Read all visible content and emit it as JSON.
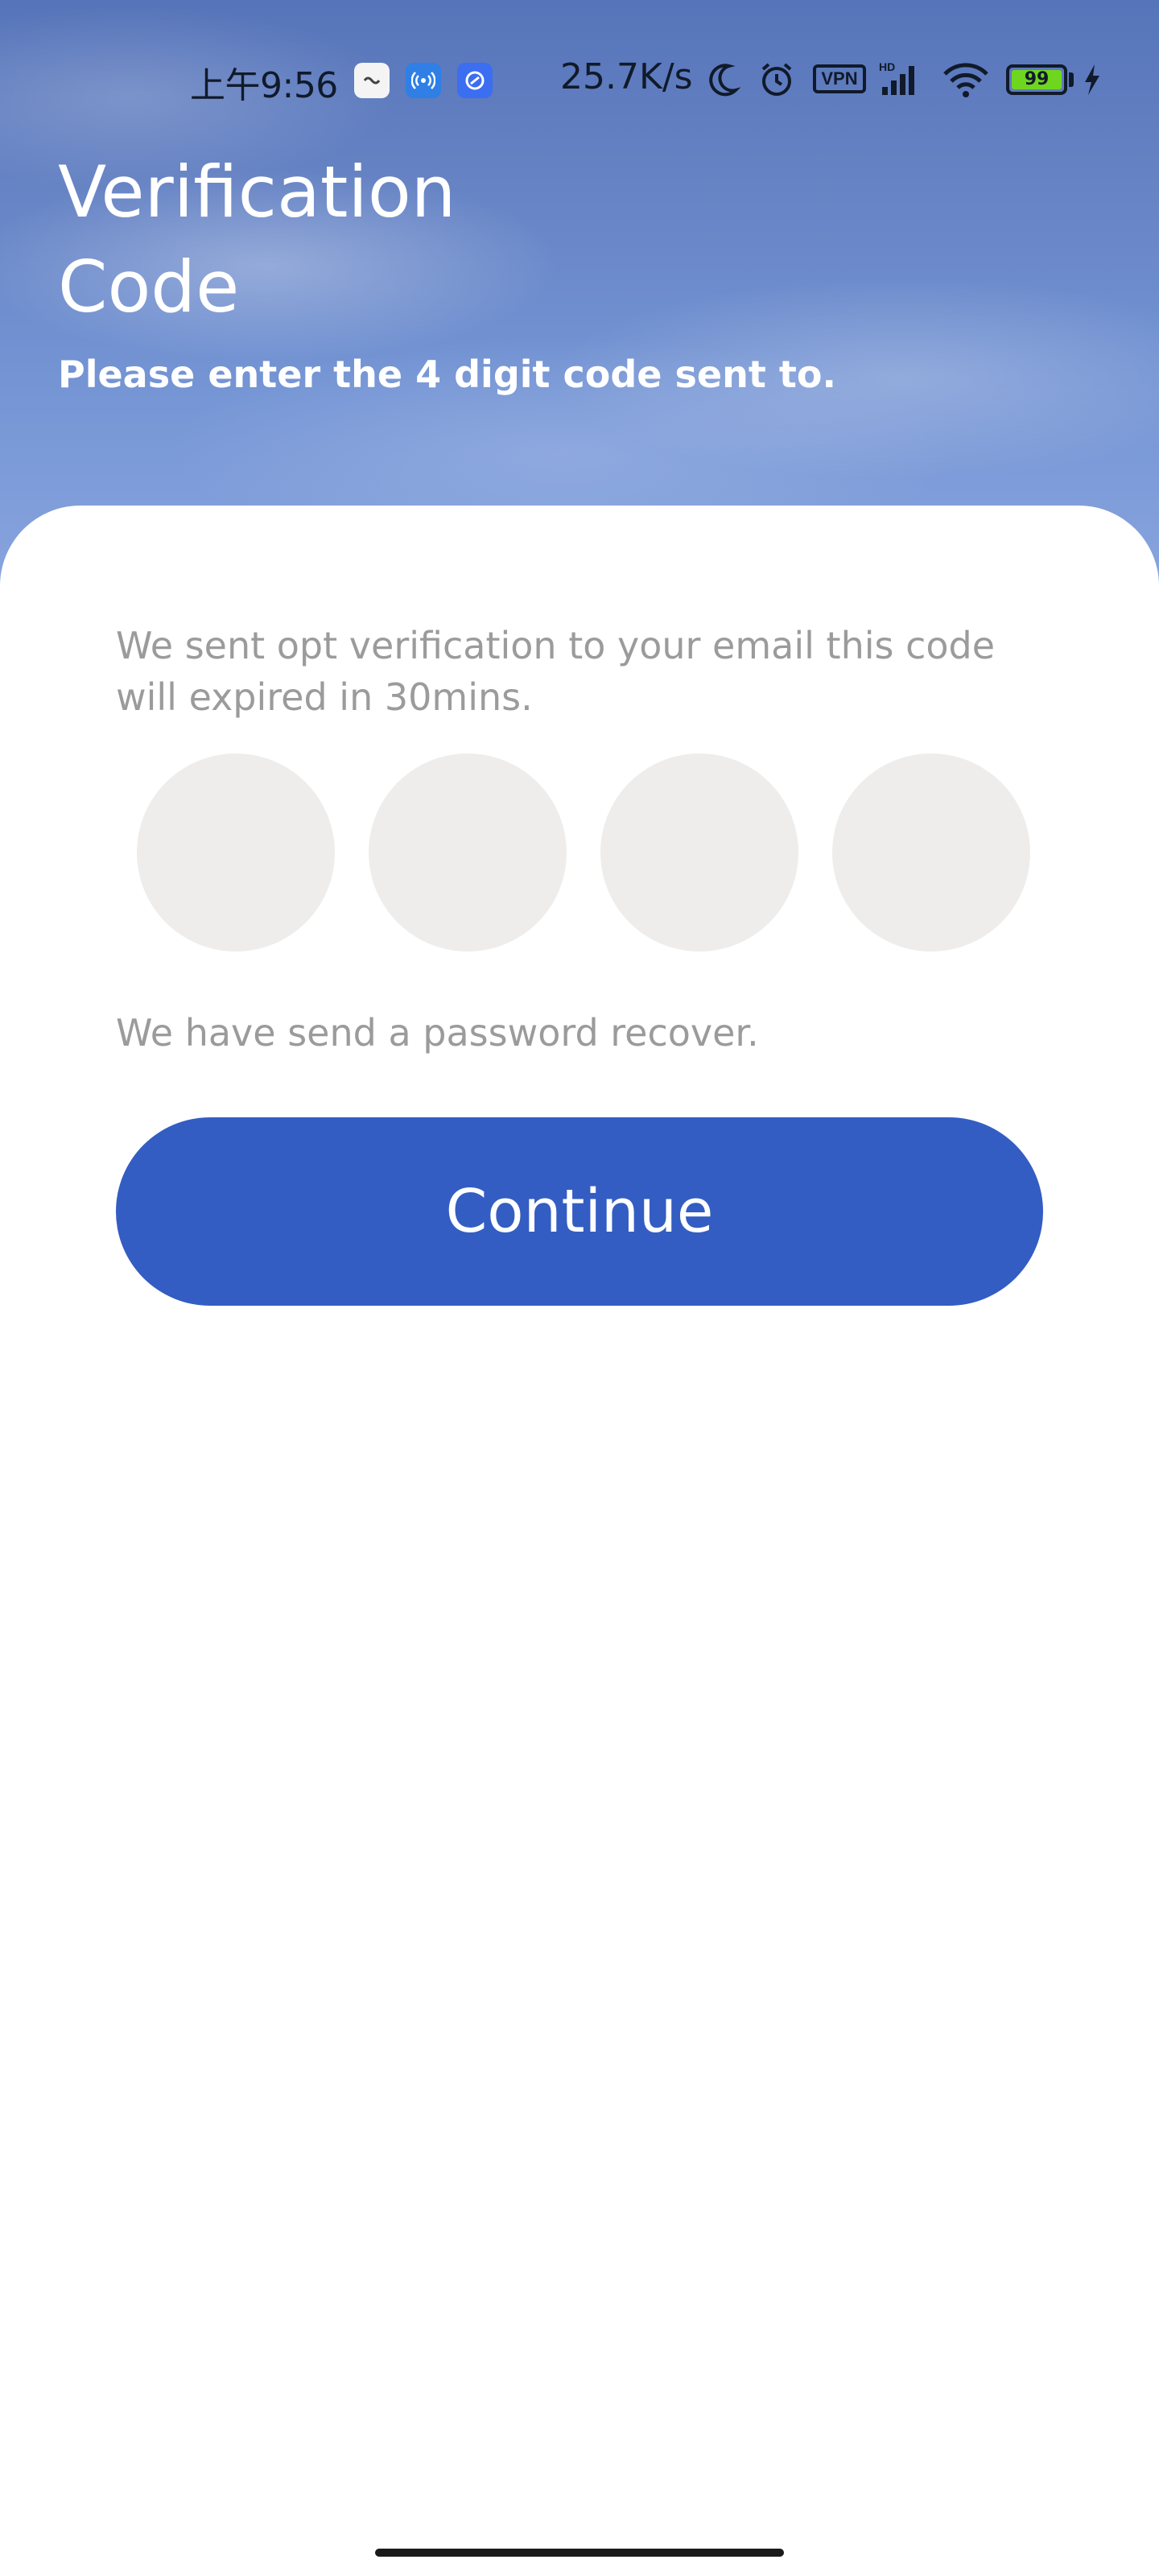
{
  "status_bar": {
    "time": "上午9:56",
    "net_speed": "25.7K/s",
    "vpn_label": "VPN",
    "battery_level": "99",
    "icons": [
      "message-icon",
      "hotspot-icon",
      "link-app-icon",
      "moon-icon",
      "alarm-icon",
      "vpn-icon",
      "signal-icon",
      "wifi-icon",
      "battery-icon",
      "charging-icon"
    ]
  },
  "header": {
    "title": "Verification Code",
    "subtitle": "Please enter the 4 digit code sent to."
  },
  "form": {
    "info_text": "We sent opt verification to your email this code will expired in 30mins.",
    "code_digits": [
      "",
      "",
      "",
      ""
    ],
    "hint_text": "We have send a password recover.",
    "continue_label": "Continue"
  },
  "colors": {
    "primary": "#335dc2",
    "code_circle": "#eeedec",
    "muted_text": "#9b9b9b",
    "battery": "#6fd61f"
  }
}
